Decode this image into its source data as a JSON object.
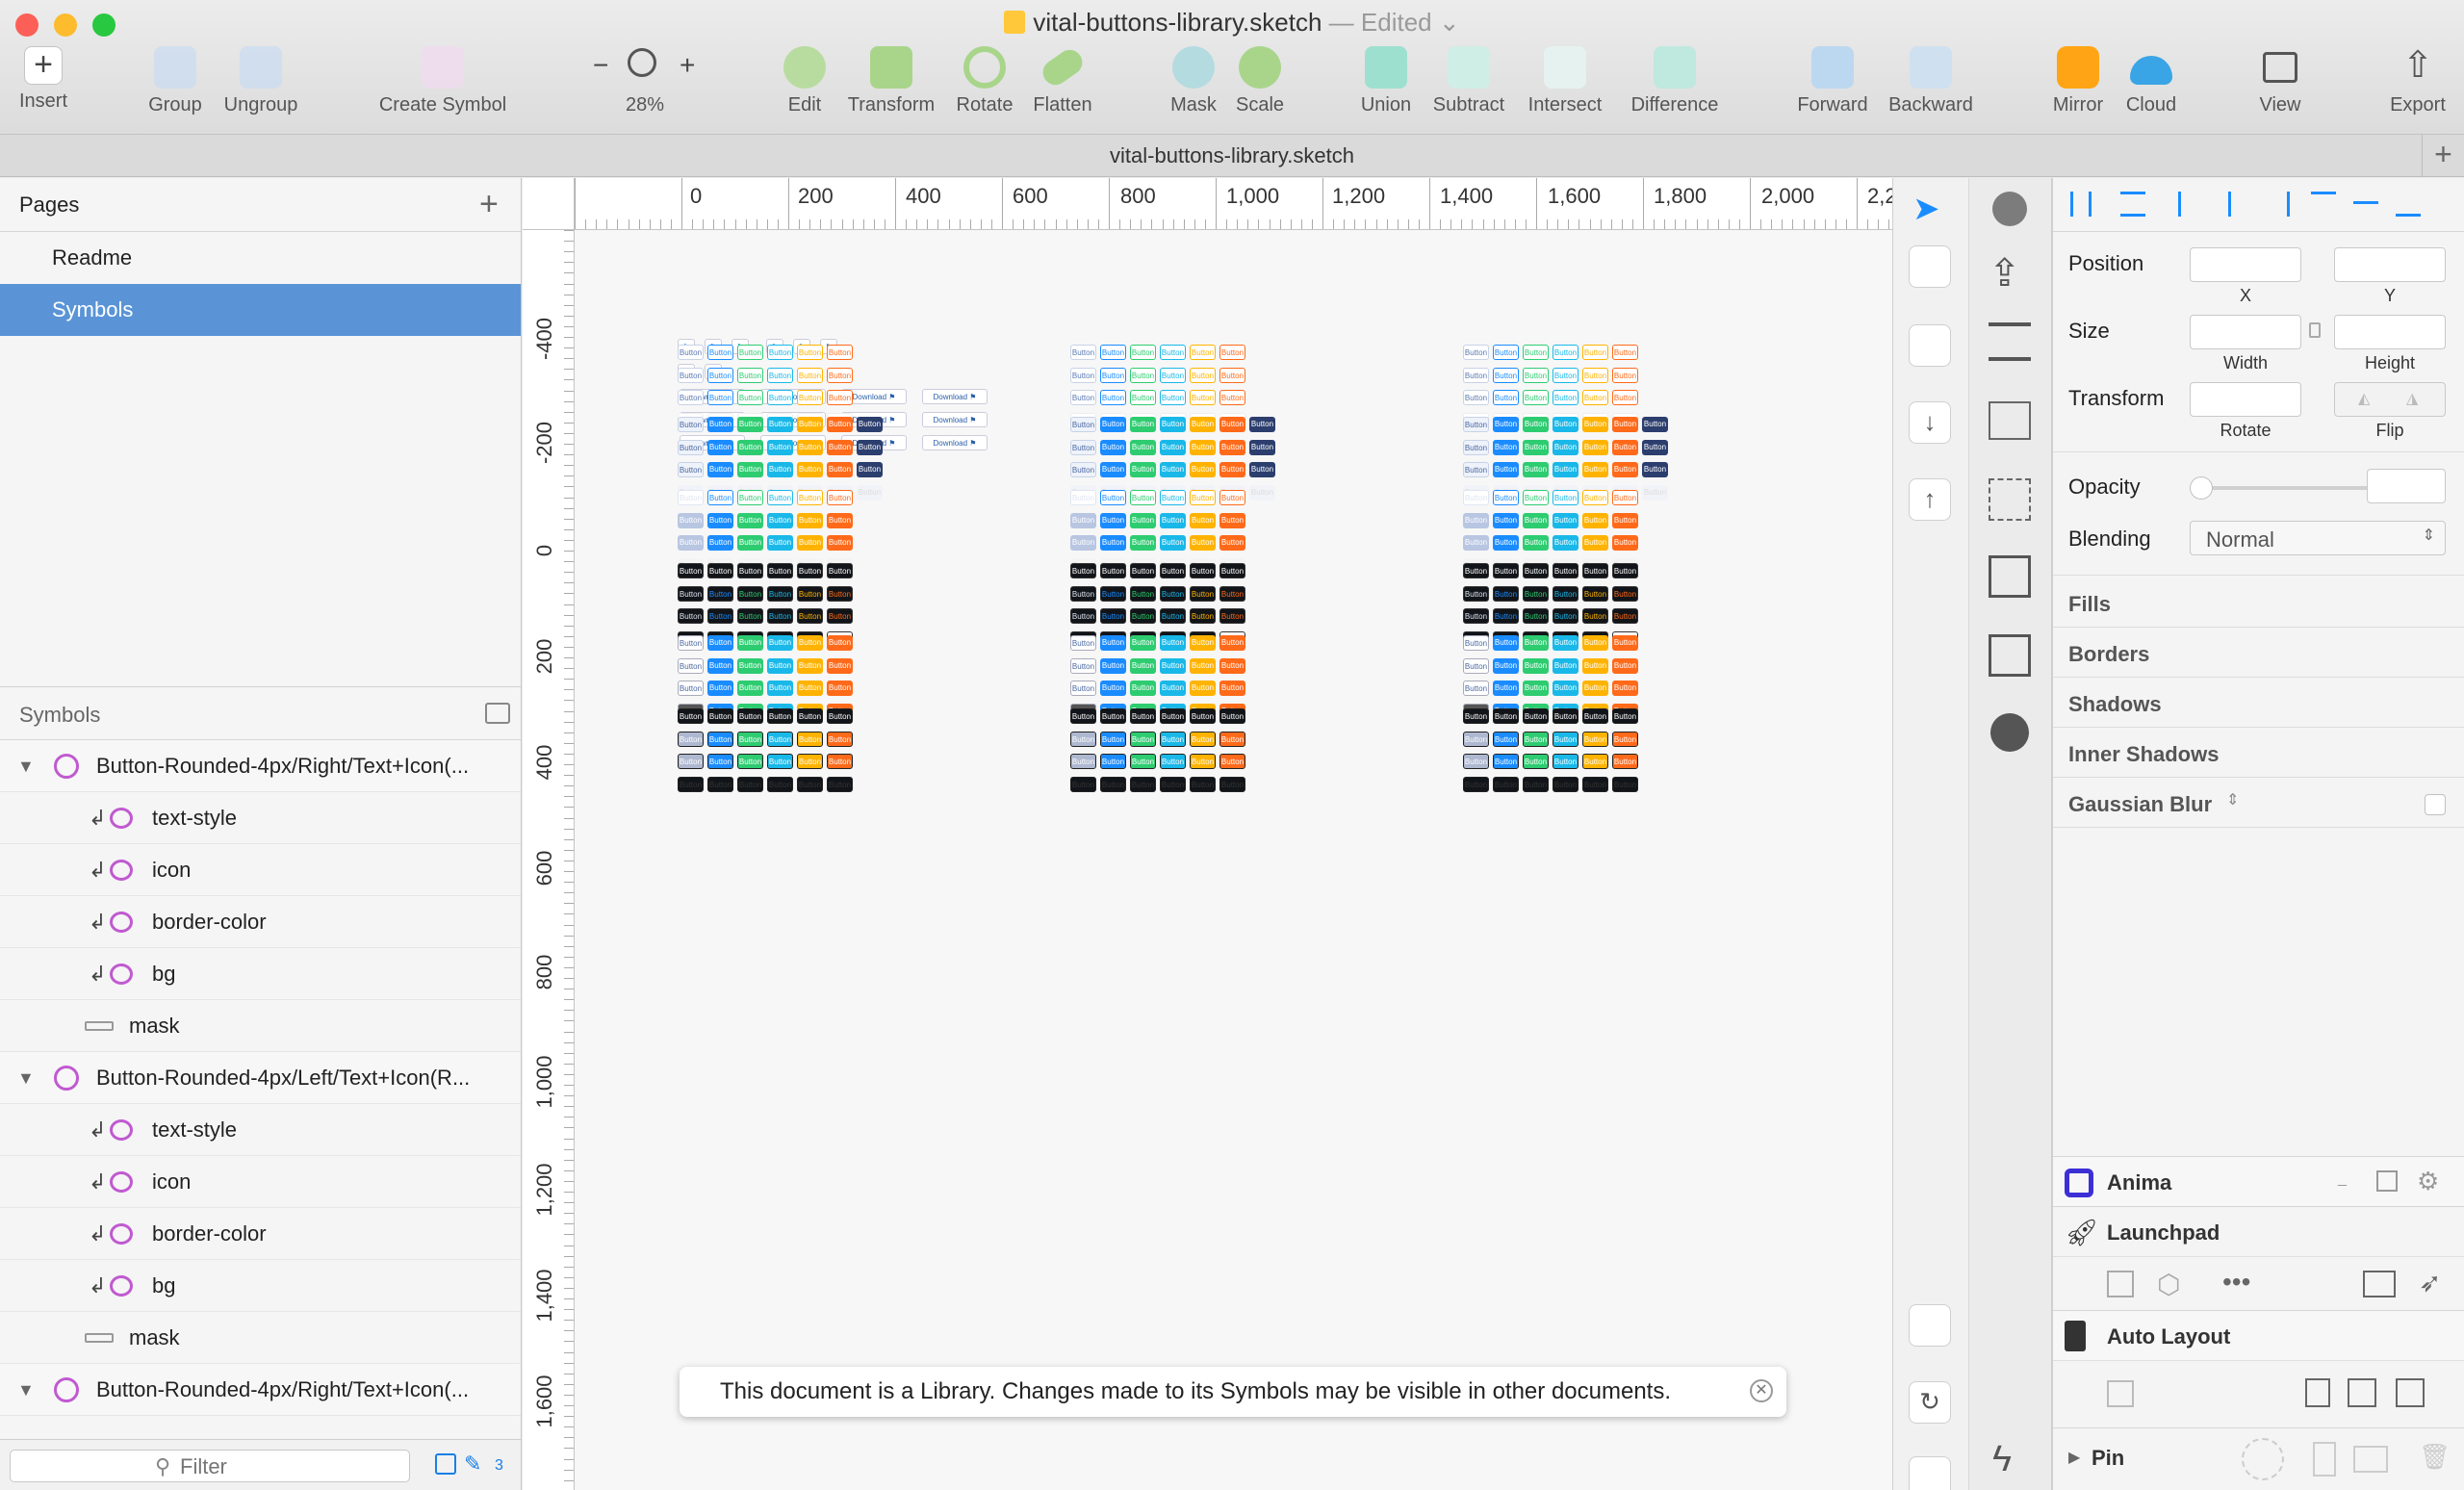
{
  "window": {
    "title": "vital-buttons-library.sketch",
    "edited": "— Edited",
    "tab_title": "vital-buttons-library.sketch"
  },
  "toolbar": {
    "insert": "Insert",
    "group": "Group",
    "ungroup": "Ungroup",
    "create_symbol": "Create Symbol",
    "zoom": "28%",
    "zoom_minus": "−",
    "zoom_plus": "+",
    "edit": "Edit",
    "transform": "Transform",
    "rotate": "Rotate",
    "flatten": "Flatten",
    "mask": "Mask",
    "scale": "Scale",
    "union": "Union",
    "subtract": "Subtract",
    "intersect": "Intersect",
    "difference": "Difference",
    "forward": "Forward",
    "backward": "Backward",
    "mirror": "Mirror",
    "cloud": "Cloud",
    "view": "View",
    "export": "Export"
  },
  "pages": {
    "header": "Pages",
    "items": [
      {
        "label": "Readme",
        "selected": false
      },
      {
        "label": "Symbols",
        "selected": true
      }
    ]
  },
  "layers": {
    "header": "Symbols",
    "items": [
      {
        "label": "Button-Rounded-4px/Right/Text+Icon(...",
        "kind": "symbol"
      },
      {
        "label": "text-style",
        "kind": "override"
      },
      {
        "label": "icon",
        "kind": "override"
      },
      {
        "label": "border-color",
        "kind": "override"
      },
      {
        "label": "bg",
        "kind": "override"
      },
      {
        "label": "mask",
        "kind": "shape"
      },
      {
        "label": "Button-Rounded-4px/Left/Text+Icon(R...",
        "kind": "symbol"
      },
      {
        "label": "text-style",
        "kind": "override"
      },
      {
        "label": "icon",
        "kind": "override"
      },
      {
        "label": "border-color",
        "kind": "override"
      },
      {
        "label": "bg",
        "kind": "override"
      },
      {
        "label": "mask",
        "kind": "shape"
      },
      {
        "label": "Button-Rounded-4px/Right/Text+Icon(...",
        "kind": "symbol"
      }
    ],
    "filter_placeholder": "Filter",
    "page_count": "3"
  },
  "rulers": {
    "h_ticks": [
      "0",
      "200",
      "400",
      "600",
      "800",
      "1,000",
      "1,200",
      "1,400",
      "1,600",
      "1,800",
      "2,000",
      "2,2"
    ],
    "v_ticks": [
      "-400",
      "-200",
      "0",
      "200",
      "400",
      "600",
      "800",
      "1,000",
      "1,200",
      "1,400",
      "1,600"
    ]
  },
  "canvas": {
    "download_label": "Download",
    "button_label": "Button",
    "colors": [
      "#dfe6f2",
      "#1a8cff",
      "#2ecc71",
      "#1ab8e8",
      "#ffb300",
      "#ff6a1a",
      "#2c3e6e"
    ],
    "dark_bg": "#111418"
  },
  "notice": {
    "text": "This document is a Library. Changes made to its Symbols may be visible in other documents."
  },
  "inspector": {
    "position": "Position",
    "x": "X",
    "y": "Y",
    "size": "Size",
    "width": "Width",
    "height": "Height",
    "transform": "Transform",
    "rotate": "Rotate",
    "flip": "Flip",
    "opacity": "Opacity",
    "blending": "Blending",
    "blending_value": "Normal",
    "fills": "Fills",
    "borders": "Borders",
    "shadows": "Shadows",
    "inner_shadows": "Inner Shadows",
    "gaussian_blur": "Gaussian Blur"
  },
  "plugins": {
    "anima": "Anima",
    "launchpad": "Launchpad",
    "auto_layout": "Auto Layout",
    "pin": "Pin"
  }
}
